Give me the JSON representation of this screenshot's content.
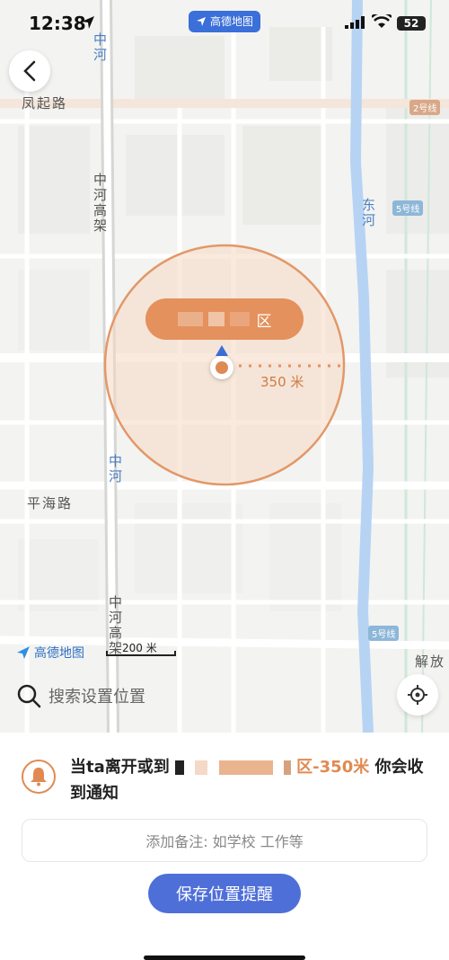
{
  "status_bar": {
    "time": "12:38",
    "battery": "52"
  },
  "app_badge": {
    "label": "高德地图"
  },
  "map": {
    "road_labels": {
      "fengqi": "凤起路",
      "zhonghe_top": "中河",
      "zhonghe_elevated": "中河高架",
      "zhonghe_mid": "中河",
      "zhonghe_elevated_bottom": "中河高架",
      "donghe": "东河",
      "pinghai": "平海路",
      "jiefang": "解放"
    },
    "metro_badges": {
      "line2": "2号线",
      "line5_top": "5号线",
      "line5_bottom": "5号线"
    },
    "place_name_suffix": "区",
    "radius_label": "350 米",
    "logo": "高德地图",
    "scale": "200 米",
    "geofence_color": "#e4915d"
  },
  "search": {
    "placeholder": "搜索设置位置"
  },
  "sheet": {
    "notice_prefix": "当ta离开或到",
    "notice_highlight": "区-350米",
    "notice_suffix": "你会收到通知",
    "note_placeholder": "添加备注: 如学校 工作等",
    "save_label": "保存位置提醒",
    "accent_color": "#e08a52",
    "button_color": "#4f6fd8"
  }
}
